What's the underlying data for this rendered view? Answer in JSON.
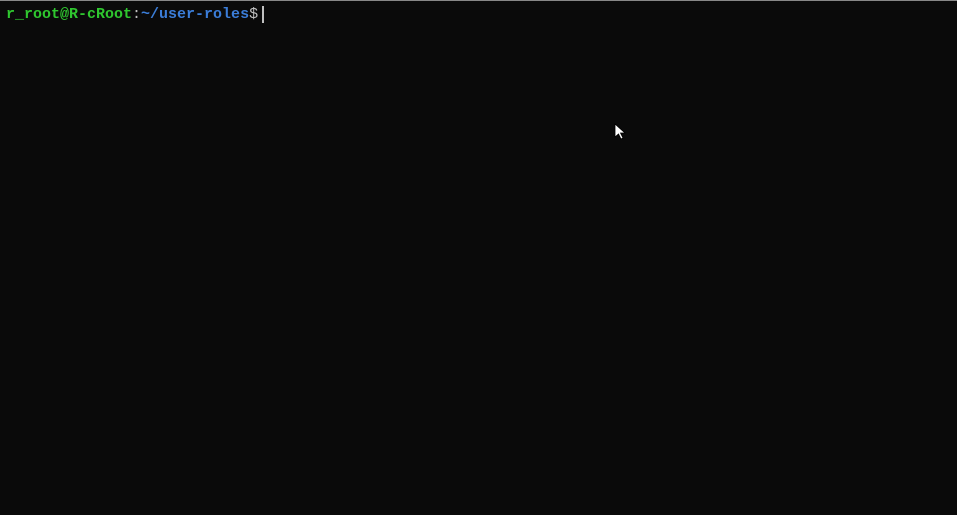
{
  "terminal": {
    "prompt": {
      "user_host": "r_root@R-cRoot",
      "separator": ":",
      "path": "~/user-roles",
      "symbol": "$"
    },
    "input": ""
  }
}
